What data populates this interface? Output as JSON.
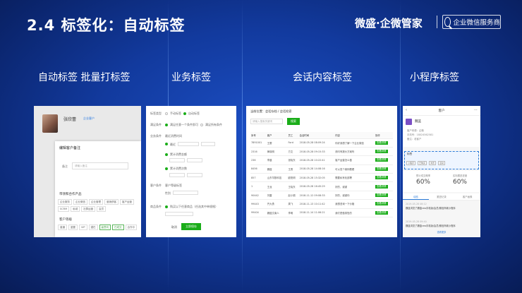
{
  "slide": {
    "title": "2.4 标签化：自动标签",
    "brand": "微盛·企微管家",
    "brand_badge": "企业微信服务商"
  },
  "sections": [
    {
      "label": "自动标签 批量打标签"
    },
    {
      "label": "业务标签"
    },
    {
      "label": "会话内容标签"
    },
    {
      "label": "小程序标签"
    }
  ],
  "panel1": {
    "customer_name": "张欣蕾",
    "customer_badge": "企业客户",
    "dialog_title": "编辑客户备注",
    "field_label": "备注",
    "field_placeholder": "请输入备注",
    "section_interest": "带领和合作产品",
    "interest_tags": [
      "企业服务",
      "企业微信",
      "企业管理",
      "营销获客",
      "客户运营",
      "SCRM",
      "私域",
      "社群运营",
      "会员"
    ],
    "section_level": "客户等级",
    "level_tags": [
      "普通",
      "重要",
      "VIP",
      "潜在",
      "高意向",
      "已成交",
      "合作中"
    ]
  },
  "panel2": {
    "rows": [
      {
        "label": "标签类型",
        "value": "手动标签",
        "alt": "自动标签"
      },
      {
        "label": "满足条件",
        "value": "满足任意一个条件即可",
        "alt": "满足所有条件"
      },
      {
        "label": "业务条件",
        "value": "最近消费时间"
      },
      {
        "label": "",
        "value": "最近"
      },
      {
        "label": "",
        "value": "累计消费金额"
      },
      {
        "label": "",
        "value": "累计消费次数"
      },
      {
        "label": "客户条件",
        "value": "客户等级标签"
      },
      {
        "label": "",
        "value": "性别"
      },
      {
        "label": "商品条件",
        "value": "购买以下任意商品（任选其中单规格）"
      }
    ],
    "cancel_label": "取消",
    "save_label": "立即保存"
  },
  "panel3": {
    "breadcrumb": "当前位置：会话存档 / 会话检索",
    "search_placeholder": "请输入搜索关键词",
    "search_button": "搜索",
    "columns": [
      "序号",
      "客户",
      "员工",
      "会话时间",
      "内容",
      "操作"
    ],
    "rows": [
      [
        "7891001",
        "王蕾",
        "Ford",
        "2018-05-28 08:09:24",
        "你好我想了解一下企业微信",
        "查看详情"
      ],
      [
        "2316",
        "黄晓明",
        "方文",
        "2018-05-28 09:15:33",
        "请问有报价方案吗",
        "查看详情"
      ],
      [
        "236",
        "李晨",
        "张晓东",
        "2018-05-28 10:22:41",
        "客户运营怎么做",
        "查看详情"
      ],
      [
        "8456",
        "魏蓝",
        "王勇",
        "2018-05-28 14:08:16",
        "可以发个案例看看",
        "查看详情"
      ],
      [
        "857",
        "山东华数科技",
        "欧阳明",
        "2018-05-28 15:32:05",
        "需要私有化部署",
        "查看详情"
      ],
      [
        "1",
        "王龙",
        "王晓东",
        "2018-05-28 16:45:29",
        "好的，谢谢",
        "查看详情"
      ],
      [
        "90442",
        "刘雷",
        "赵小娟",
        "2018-11-12 09:08:33",
        "好的，谢谢你",
        "查看详情"
      ],
      [
        "99443",
        "齐大勇",
        "周飞",
        "2018-11-13 10:11:42",
        "我想咨询一下价格",
        "查看详情"
      ],
      [
        "99404",
        "魏蓝文南人",
        "李明",
        "2018-11-14 11:06:21",
        "我们是做零售的",
        "查看详情"
      ]
    ]
  },
  "panel4": {
    "app_title": "客户",
    "back_icon": "chevron-left-icon",
    "customer_name": "魏蓝",
    "info_lines": [
      "客户来源：企微",
      "手机号：18024562581",
      "备注：老客户"
    ],
    "tag_box_label": "标签",
    "tag_box_tags": [
      "小程序",
      "已购买",
      "浏览",
      "活动"
    ],
    "stat_left_label": "预计成交概率",
    "stat_left_value": "60%",
    "stat_right_label": "实际跟进进度",
    "stat_right_value": "60%",
    "tabs": [
      "动态",
      "跟进记录",
      "客户画像"
    ],
    "feed": [
      {
        "time": "2019-05-28 08:12",
        "text": "魏蓝浏览了魏蓝ceo手机版/会员/微信商城小程序"
      },
      {
        "time": "2019-05-28 09:40",
        "text": "魏蓝浏览了魏蓝ceo手机版/会员/微信商城小程序"
      }
    ],
    "more_label": "查看更多"
  }
}
